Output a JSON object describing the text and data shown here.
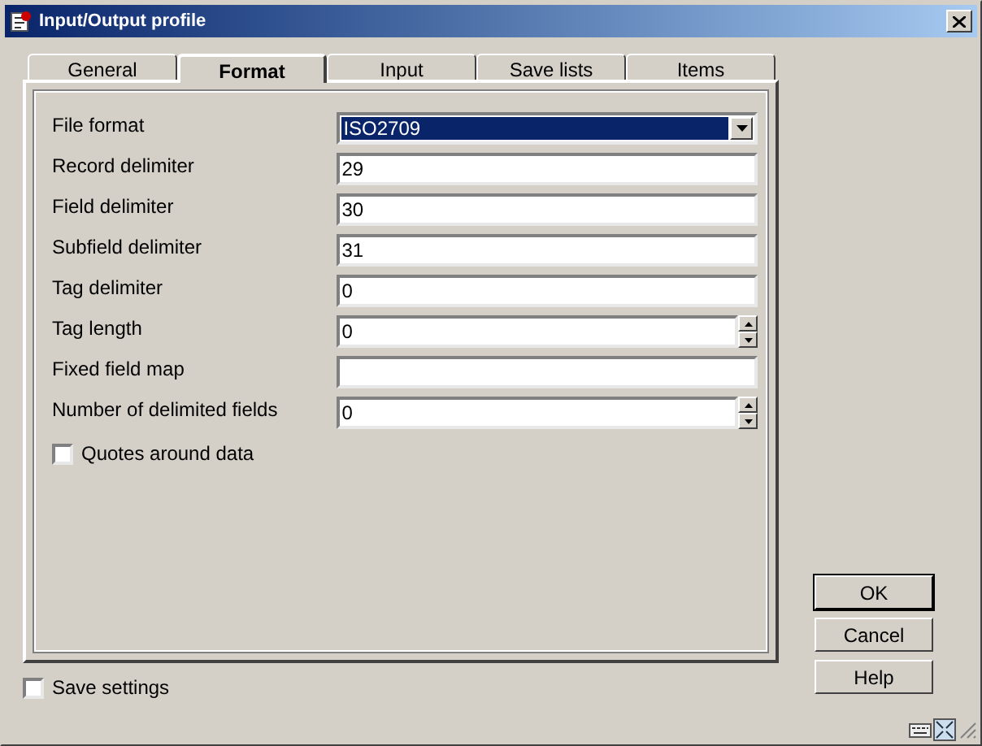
{
  "window": {
    "title": "Input/Output profile"
  },
  "tabs": [
    {
      "label": "General",
      "selected": false
    },
    {
      "label": "Format",
      "selected": true
    },
    {
      "label": "Input",
      "selected": false
    },
    {
      "label": "Save lists",
      "selected": false
    },
    {
      "label": "Items",
      "selected": false
    }
  ],
  "fields": [
    {
      "kind": "dropdown",
      "label": "File format",
      "value": "ISO2709",
      "highlighted": true
    },
    {
      "kind": "text",
      "label": "Record delimiter",
      "value": "29"
    },
    {
      "kind": "text",
      "label": "Field delimiter",
      "value": "30"
    },
    {
      "kind": "text",
      "label": "Subfield delimiter",
      "value": "31"
    },
    {
      "kind": "text",
      "label": "Tag delimiter",
      "value": "0"
    },
    {
      "kind": "spin",
      "label": "Tag length",
      "value": "0"
    },
    {
      "kind": "text",
      "label": "Fixed field map"
    },
    {
      "kind": "spin",
      "label": "Number of delimited fields",
      "value": "0"
    }
  ],
  "quotes_checkbox": {
    "label": "Quotes around data",
    "checked": false
  },
  "save_settings_checkbox": {
    "label": "Save settings",
    "checked": false
  },
  "buttons": [
    {
      "label": "OK",
      "default": true
    },
    {
      "label": "Cancel",
      "default": false
    },
    {
      "label": "Help",
      "default": false
    }
  ]
}
